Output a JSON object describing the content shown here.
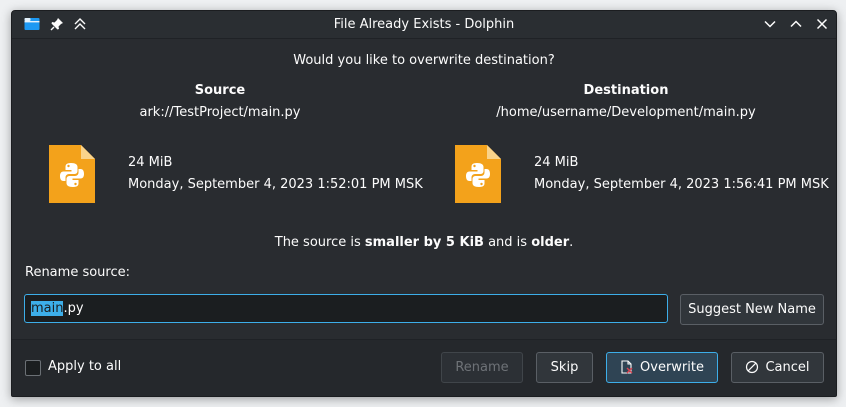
{
  "window": {
    "title": "File Already Exists - Dolphin"
  },
  "dialog": {
    "question": "Would you like to overwrite destination?",
    "source": {
      "heading": "Source",
      "path": "ark://TestProject/main.py",
      "size": "24 MiB",
      "modified": "Monday, September 4, 2023 1:52:01 PM MSK"
    },
    "destination": {
      "heading": "Destination",
      "path": "/home/username/Development/main.py",
      "size": "24 MiB",
      "modified": "Monday, September 4, 2023 1:56:41 PM MSK"
    },
    "summary": {
      "prefix": "The source is ",
      "size_diff": "smaller by 5 KiB",
      "middle": " and is ",
      "age": "older",
      "suffix": "."
    },
    "rename": {
      "label": "Rename source:",
      "value_selected": "main",
      "value_rest": ".py",
      "suggest_label": "Suggest New Name"
    },
    "footer": {
      "apply_all_label": "Apply to all",
      "rename_label": "Rename",
      "skip_label": "Skip",
      "overwrite_label": "Overwrite",
      "cancel_label": "Cancel"
    }
  },
  "colors": {
    "accent": "#3daee9",
    "file_icon": "#f3a21b",
    "background": "#292c30"
  },
  "icons": {
    "app": "folder-icon",
    "pin": "pin-icon",
    "keep_above": "keep-above-icon",
    "minimize": "chevron-down-icon",
    "maximize": "chevron-up-icon",
    "close": "close-icon",
    "file": "python-file-icon",
    "overwrite": "document-overwrite-icon",
    "cancel": "cancel-icon"
  }
}
